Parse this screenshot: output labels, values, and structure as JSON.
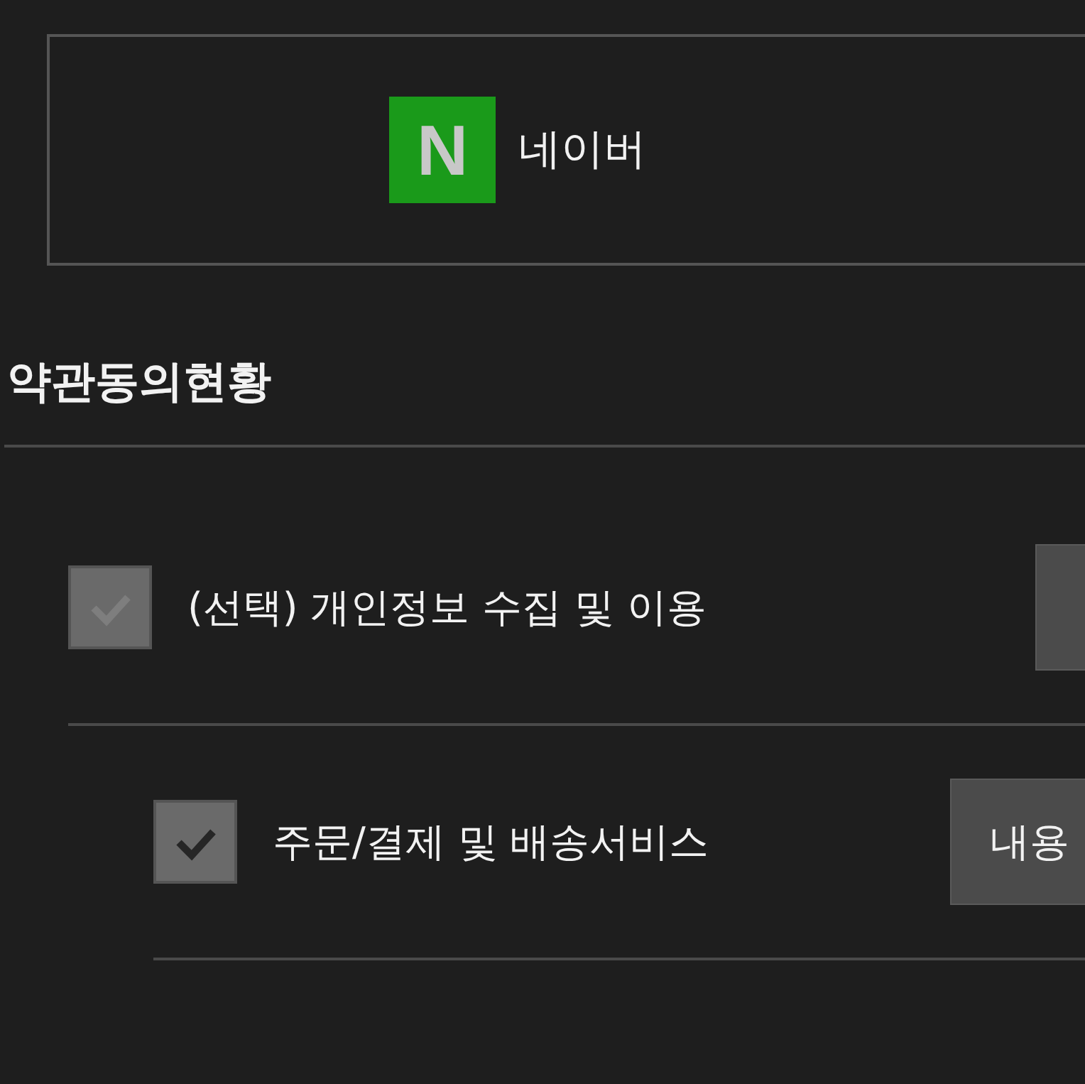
{
  "login_provider": {
    "logo_letter": "N",
    "label": "네이버"
  },
  "terms": {
    "title": "약관동의현황",
    "items": [
      {
        "label": "(선택) 개인정보 수집 및 이용",
        "checked": false,
        "children": [
          {
            "label": "주문/결제 및 배송서비스",
            "checked": true,
            "button": "내용"
          }
        ]
      }
    ]
  }
}
